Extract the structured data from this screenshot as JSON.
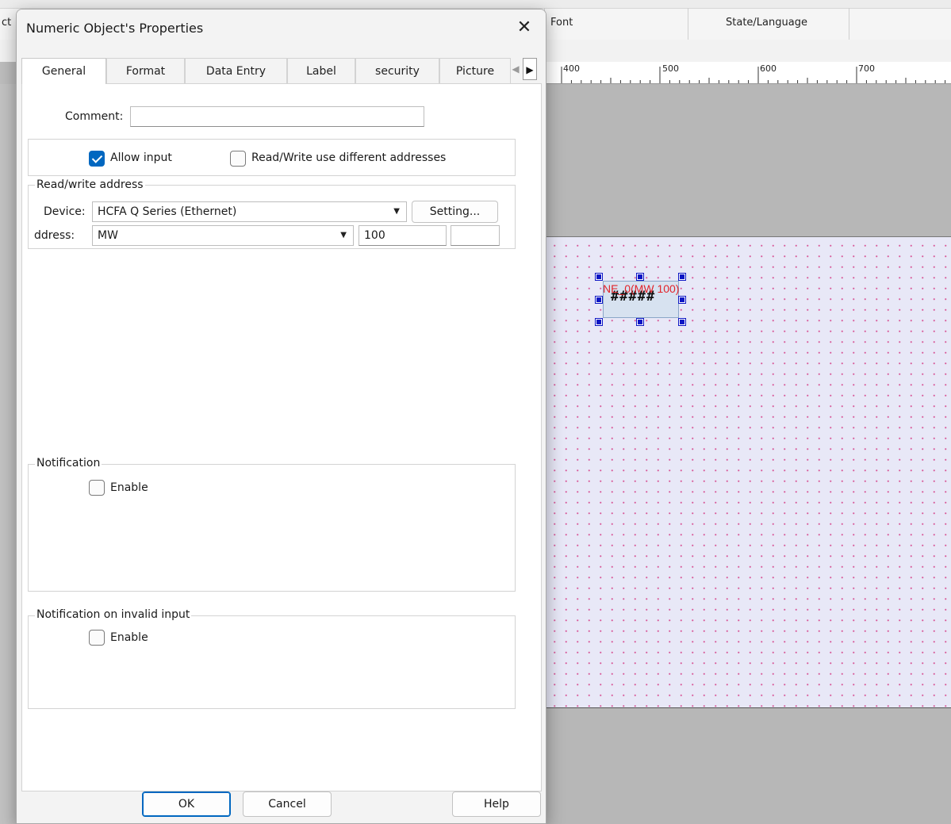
{
  "background": {
    "left_header_fragment": "ct",
    "column_headers": [
      "Font",
      "State/Language"
    ],
    "ruler_labels": [
      "400",
      "500",
      "600",
      "700"
    ],
    "object": {
      "label": "NE_0(MW 100)",
      "display": "#####"
    }
  },
  "dialog": {
    "title": "Numeric Object's Properties",
    "close_glyph": "✕",
    "tabs": [
      "General",
      "Format",
      "Data Entry",
      "Label",
      "security",
      "Picture"
    ],
    "active_tab": "General",
    "tab_scroll_left": "◀",
    "tab_scroll_right": "▶",
    "comment": {
      "label": "Comment:",
      "value": ""
    },
    "allow_input": {
      "label": "Allow input",
      "checked": true
    },
    "rw_diff": {
      "label": "Read/Write use different addresses",
      "checked": false
    },
    "rw_address": {
      "title": "Read/write address",
      "device_label": "Device:",
      "device_value": "HCFA Q Series (Ethernet)",
      "setting_label": "Setting...",
      "address_label": "ddress:",
      "address_type": "MW",
      "address_value": "100",
      "address_extra": ""
    },
    "notification": {
      "title": "Notification",
      "enable_label": "Enable",
      "enabled": false
    },
    "notification_invalid": {
      "title": "Notification on invalid input",
      "enable_label": "Enable",
      "enabled": false
    },
    "buttons": {
      "ok": "OK",
      "cancel": "Cancel",
      "help": "Help"
    },
    "dropdown_glyph": "▼"
  },
  "colors": {
    "accent": "#0067c0",
    "object_label": "#e2242a",
    "handle": "#0d16c4",
    "canvas": "#e8e8f7"
  }
}
